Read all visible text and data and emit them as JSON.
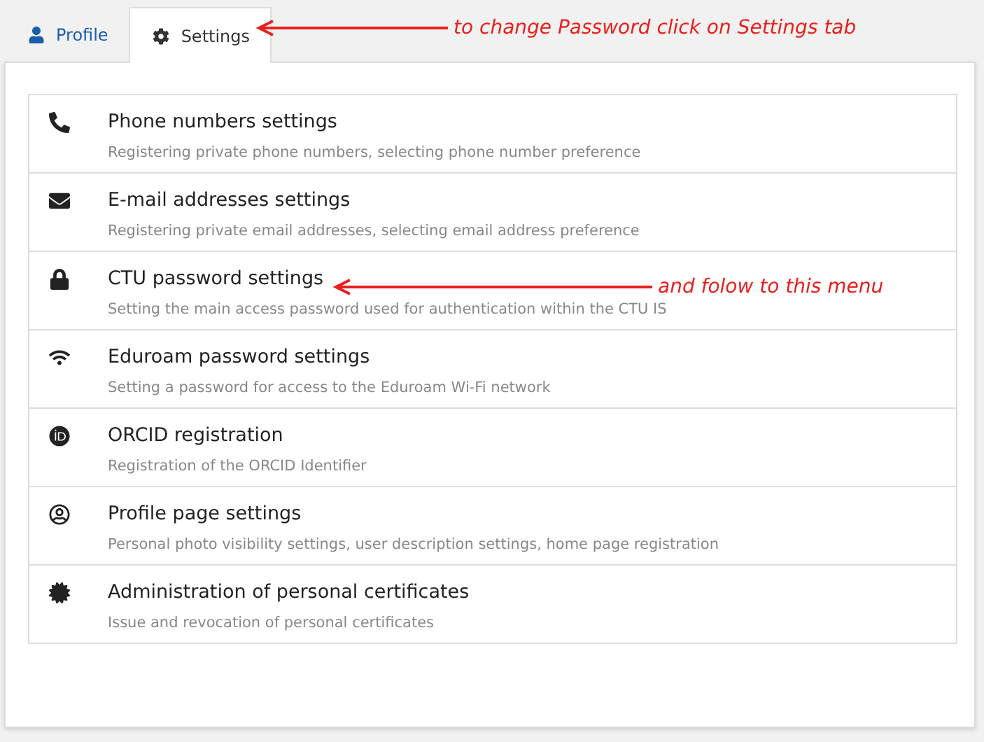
{
  "tabs": [
    {
      "label": "Profile",
      "kind": "user",
      "selected": false
    },
    {
      "label": "Settings",
      "kind": "gear",
      "selected": true
    }
  ],
  "menu": [
    {
      "kind": "phone",
      "title": "Phone numbers settings",
      "description": "Registering private phone numbers, selecting phone number preference"
    },
    {
      "kind": "envelope",
      "title": "E-mail addresses settings",
      "description": "Registering private email addresses, selecting email address preference"
    },
    {
      "kind": "lock",
      "title": "CTU password settings",
      "description": "Setting the main access password used for authentication within the CTU IS"
    },
    {
      "kind": "wifi",
      "title": "Eduroam password settings",
      "description": "Setting a password for access to the Eduroam Wi-Fi network"
    },
    {
      "kind": "orcid",
      "title": "ORCID registration",
      "description": "Registration of the ORCID Identifier"
    },
    {
      "kind": "user-circle",
      "title": "Profile page settings",
      "description": "Personal photo visibility settings, user description settings, home page registration"
    },
    {
      "kind": "certificate",
      "title": "Administration of personal certificates",
      "description": "Issue and revocation of personal certificates"
    }
  ],
  "annotations": [
    {
      "text": "to change Password click on Settings tab"
    },
    {
      "text": "and folow to this menu"
    }
  ]
}
